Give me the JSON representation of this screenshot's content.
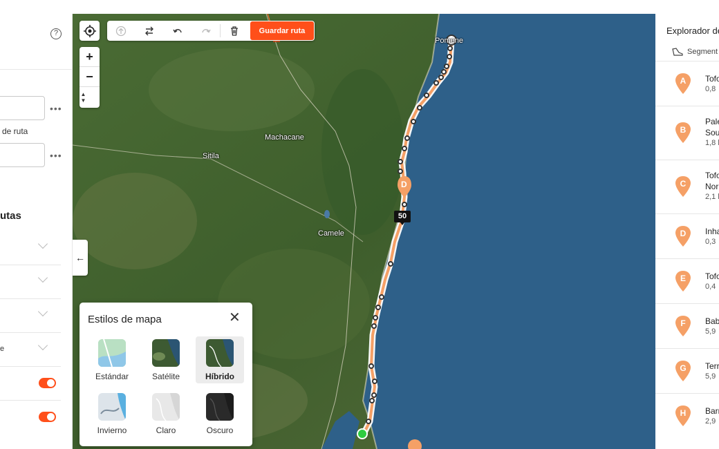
{
  "left_panel": {
    "help_icon": "?",
    "input_dots": "•••",
    "route_label_fragment": "de ruta",
    "section_fragment": "utas",
    "row_fragment": "e"
  },
  "map": {
    "places": {
      "machacane": "Machacane",
      "sitila": "Sitila",
      "camele": "Camele",
      "pomene": "Pomene"
    },
    "distance_badge": "50",
    "waypoint_label": "D",
    "toolbar": {
      "save_label": "Guardar ruta"
    },
    "zoom_in": "+",
    "zoom_out": "−",
    "compass": "▲▼",
    "collapse_arrow": "←"
  },
  "map_styles": {
    "title": "Estilos de mapa",
    "close": "✕",
    "options": [
      {
        "label": "Estándar",
        "selected": false
      },
      {
        "label": "Satélite",
        "selected": false
      },
      {
        "label": "Híbrido",
        "selected": true
      },
      {
        "label": "Invierno",
        "selected": false
      },
      {
        "label": "Claro",
        "selected": false
      },
      {
        "label": "Oscuro",
        "selected": false
      }
    ]
  },
  "right_panel": {
    "title": "Explorador de",
    "segments_label": "Segment",
    "items": [
      {
        "letter": "A",
        "name": "Tofo",
        "sub": "0,8"
      },
      {
        "letter": "B",
        "name": "Pale",
        "name2": "Sou",
        "sub": "1,8 k"
      },
      {
        "letter": "C",
        "name": "Tofo",
        "name2": "Nor",
        "sub": "2,1 k"
      },
      {
        "letter": "D",
        "name": "Inha",
        "sub": "0,3"
      },
      {
        "letter": "E",
        "name": "Tofo",
        "sub": "0,4"
      },
      {
        "letter": "F",
        "name": "Bab",
        "sub": "5,9"
      },
      {
        "letter": "G",
        "name": "Terr",
        "sub": "5,9"
      },
      {
        "letter": "H",
        "name": "Barr",
        "sub": "2,9"
      }
    ]
  },
  "colors": {
    "accent": "#ff4f1a",
    "pin": "#f5a066",
    "ocean": "#2e6089"
  }
}
